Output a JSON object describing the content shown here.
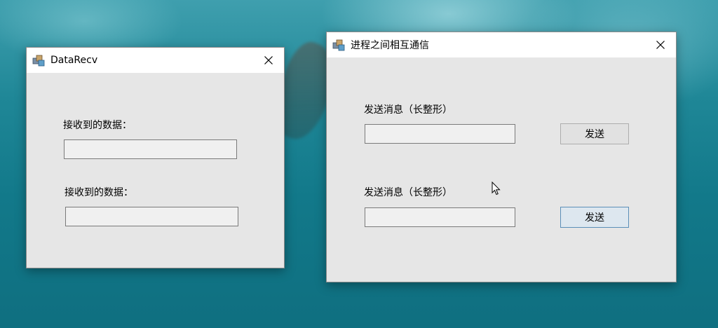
{
  "window_left": {
    "title": "DataRecv",
    "label1": "接收到的数据：",
    "field1_value": "",
    "label2": "接收到的数据：",
    "field2_value": ""
  },
  "window_right": {
    "title": "进程之间相互通信",
    "label1": "发送消息（长整形）",
    "field1_value": "",
    "send1_label": "发送",
    "label2": "发送消息（长整形）",
    "field2_value": "",
    "send2_label": "发送"
  },
  "icons": {
    "app": "app-icon",
    "close": "close-icon",
    "cursor": "mouse-pointer-icon"
  },
  "colors": {
    "window_bg": "#e6e6e6",
    "titlebar_bg": "#ffffff",
    "focus_border": "#5b8fb8"
  }
}
